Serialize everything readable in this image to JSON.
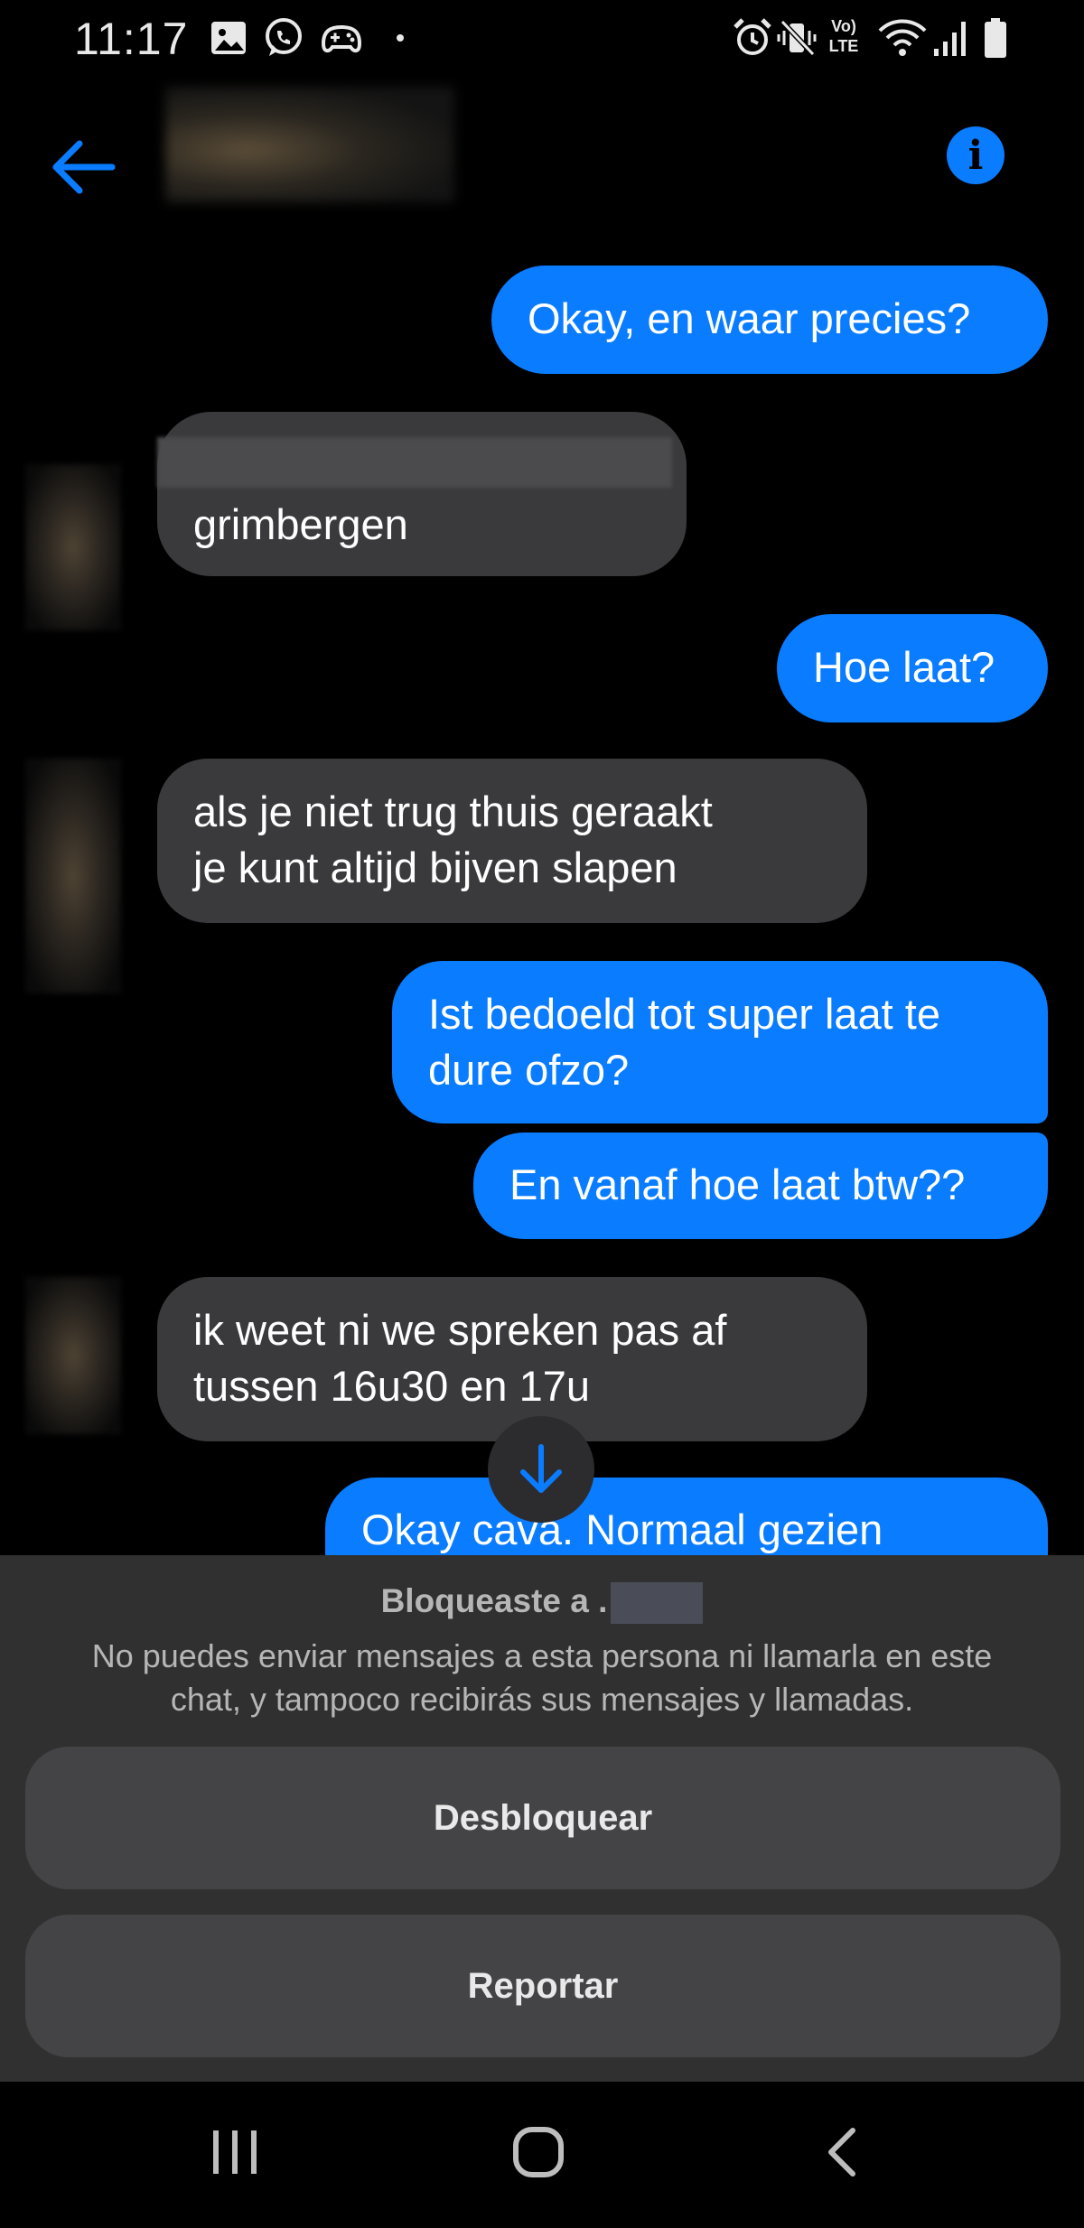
{
  "status_bar": {
    "time": "11:17",
    "left_icons": [
      "image-icon",
      "whatsapp-icon",
      "gamepad-icon",
      "dot-icon"
    ],
    "right_icons": [
      "alarm-icon",
      "vibrate-icon",
      "volte-icon",
      "wifi-icon",
      "signal-icon",
      "battery-icon"
    ],
    "volte_label_top": "Vo)",
    "volte_label_bottom": "LTE"
  },
  "header": {
    "back_icon": "arrow-left-icon",
    "info_icon": "info-icon",
    "accent_color": "#0a7cff"
  },
  "messages": [
    {
      "direction": "outgoing",
      "lines": [
        "Okay, en waar precies?"
      ]
    },
    {
      "direction": "incoming",
      "lines": [
        "grimbergen"
      ]
    },
    {
      "direction": "outgoing",
      "lines": [
        "Hoe laat?"
      ]
    },
    {
      "direction": "incoming",
      "lines": [
        "als je niet trug thuis geraakt",
        "je kunt altijd bijven slapen"
      ]
    },
    {
      "direction": "outgoing",
      "lines": [
        "Ist bedoeld tot super laat te",
        "dure ofzo?"
      ]
    },
    {
      "direction": "outgoing",
      "lines": [
        "En vanaf hoe laat btw??"
      ]
    },
    {
      "direction": "incoming",
      "lines": [
        "ik weet ni we spreken pas af",
        "tussen 16u30 en 17u"
      ]
    },
    {
      "direction": "outgoing",
      "lines": [
        "Okay cava. Normaal gezien"
      ]
    }
  ],
  "block_panel": {
    "title": "Bloqueaste a .",
    "description": "No puedes enviar mensajes a esta persona ni llamarla en este chat, y tampoco recibirás sus mensajes y llamadas.",
    "unblock_label": "Desbloquear",
    "report_label": "Reportar"
  },
  "nav_bar": {
    "icons": [
      "recent-apps-icon",
      "home-icon",
      "back-nav-icon"
    ]
  }
}
